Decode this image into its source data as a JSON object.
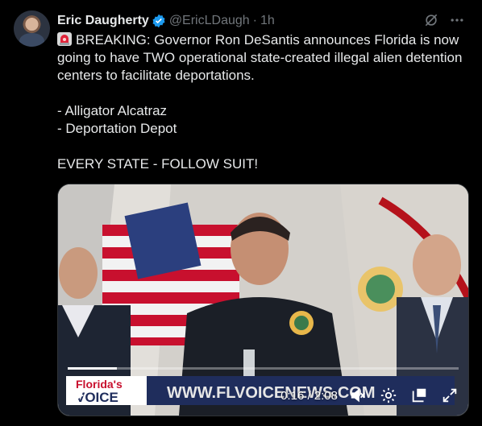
{
  "author": {
    "name": "Eric Daugherty",
    "handle": "@EricLDaugh",
    "time": "1h",
    "verified_color": "#1d9bf0"
  },
  "tweet": {
    "line1": "BREAKING: Governor Ron DeSantis announces Florida is now going to have TWO operational state-created illegal alien detention centers to facilitate deportations.",
    "item1": "- Alligator Alcatraz",
    "item2": "- Deportation Depot",
    "closing": "EVERY STATE - FOLLOW SUIT!"
  },
  "video": {
    "time": "0:16 / 2:08",
    "progress": 0.125,
    "banner_text": "WWW.FLVOICENEWS.COM",
    "logo_line1": "Florida's",
    "logo_line2": "VOICE"
  },
  "colors": {
    "text": "#e7e9ea",
    "muted": "#71767b",
    "accent": "#1d9bf0"
  }
}
